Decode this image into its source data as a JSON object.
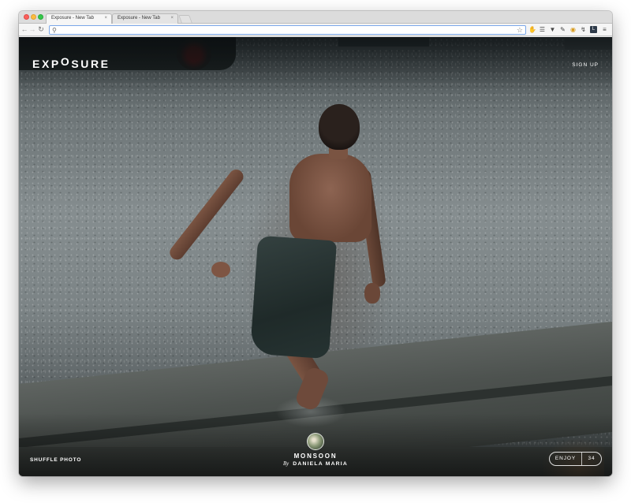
{
  "browser": {
    "tabs": [
      {
        "label": "Exposure - New Tab",
        "close": "×"
      },
      {
        "label": "Exposure - New Tab",
        "close": "×"
      }
    ],
    "address_value": "",
    "icons": {
      "back": "back-arrow-icon",
      "forward": "forward-arrow-icon",
      "reload": "reload-icon",
      "search": "search-icon",
      "bookmark": "star-icon",
      "menu": "hamburger-menu-icon"
    }
  },
  "page": {
    "logo": {
      "pre": "EXP",
      "lifted": "O",
      "post": "SURE"
    },
    "signup_label": "SIGN UP",
    "shuffle_label": "SHUFFLE PHOTO",
    "photo": {
      "title": "MONSOON",
      "by": "By",
      "author": "DANIELA MARIA"
    },
    "enjoy": {
      "label": "ENJOY",
      "count": "34"
    }
  },
  "colors": {
    "accent_focus": "#7aa7e9",
    "overlay_text": "#ffffff"
  }
}
